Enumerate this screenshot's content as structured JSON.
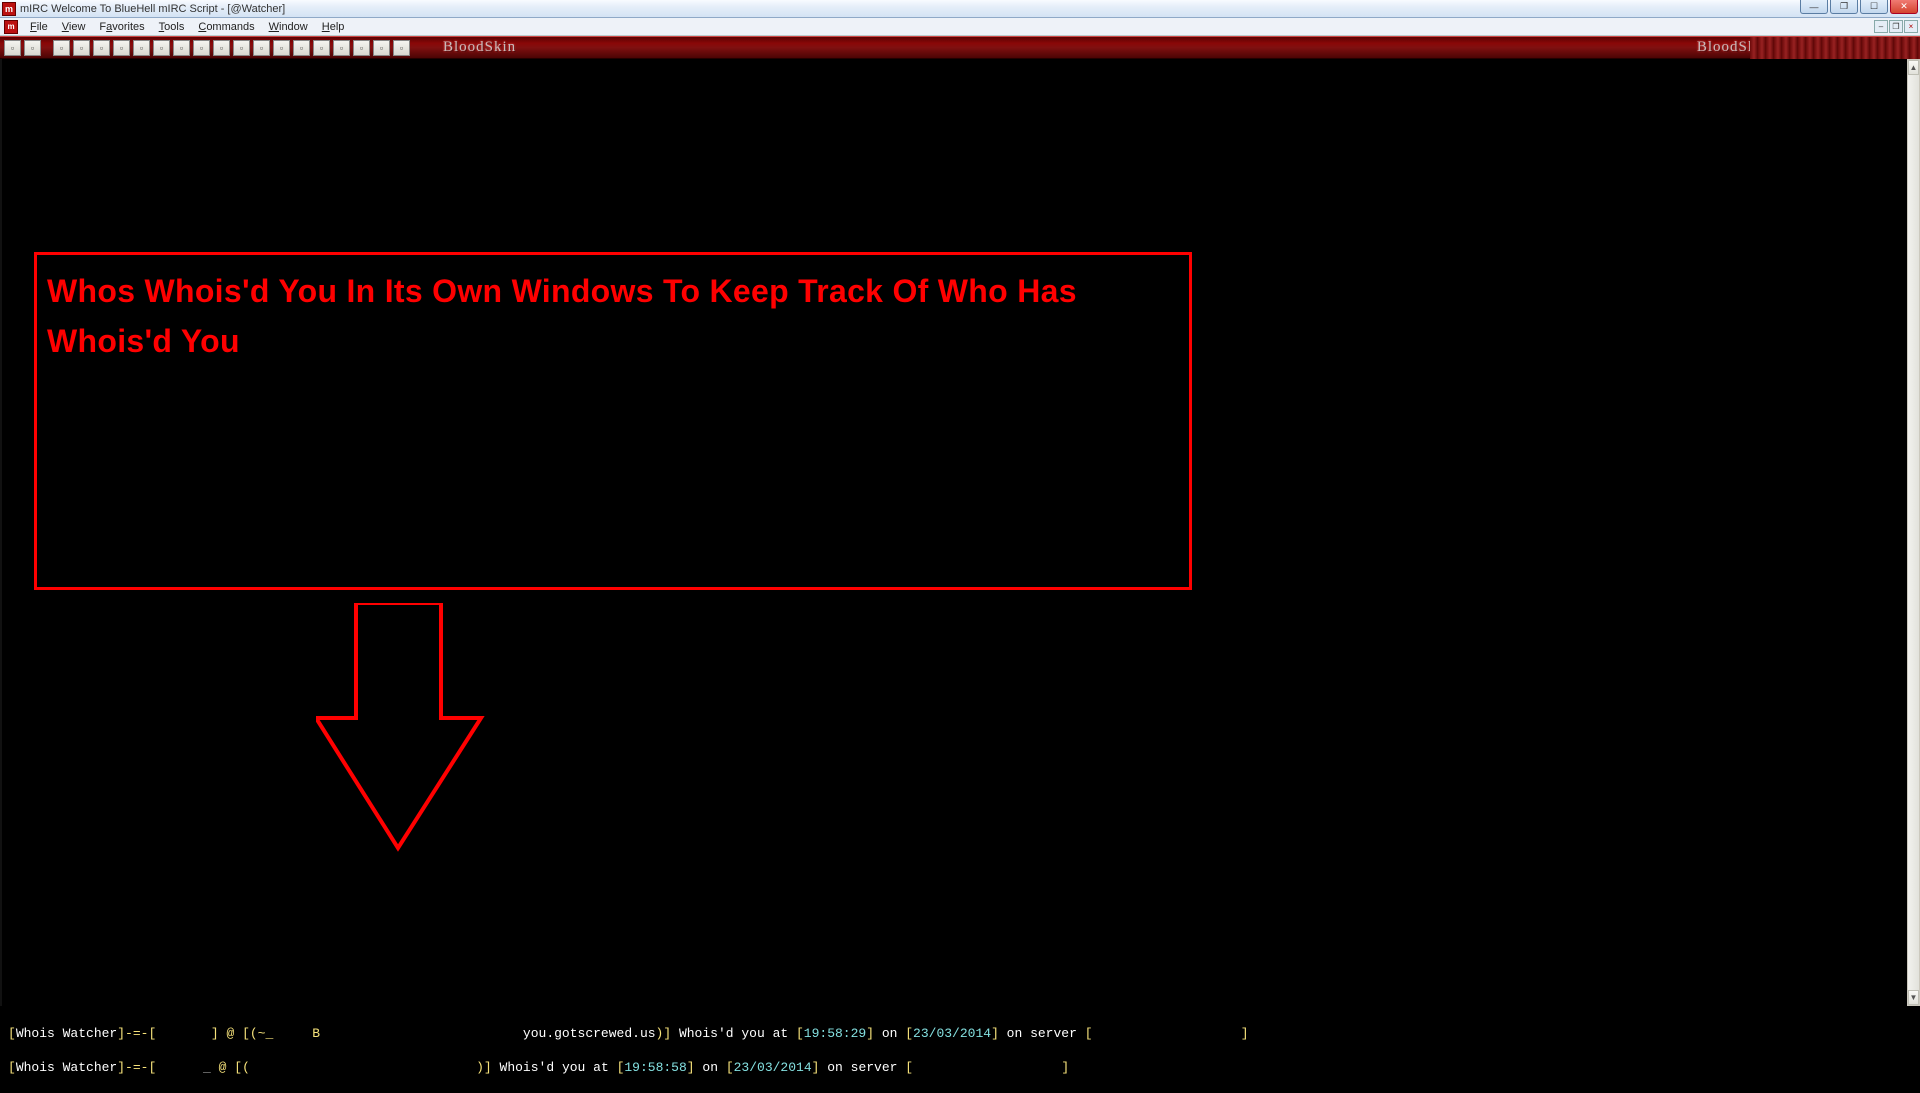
{
  "window": {
    "title": "mIRC Welcome To BlueHell mIRC Script - [@Watcher]"
  },
  "menu": {
    "file": "File",
    "view": "View",
    "favorites": "Favorites",
    "tools": "Tools",
    "commands": "Commands",
    "window": "Window",
    "help": "Help"
  },
  "brand": "BloodSkin",
  "callout": {
    "text": "Whos Whois'd You In Its Own Windows To Keep Track Of Who Has Whois'd You"
  },
  "log": {
    "line1": {
      "prefix": "[",
      "label": "Whois Watcher",
      "sep1": "]-=-[",
      "blank1": "       ",
      "mid1": "] @ [(~_     B",
      "host": "you.gotscrewed.us",
      "after_host": ")] ",
      "msg": "Whois'd you at ",
      "b1": "[",
      "time": "19:58:29",
      "b2": "] ",
      "on": "on ",
      "b3": "[",
      "date": "23/03/2014",
      "b4": "] ",
      "srv": "on server ",
      "b5": "[",
      "tail_close": "]"
    },
    "line2": {
      "prefix": "[",
      "label": "Whois Watcher",
      "sep1": "]-=-[",
      "blank1": "      _",
      "mid1": " @ [(",
      "host_close": ")] ",
      "msg": "Whois'd you at ",
      "b1": "[",
      "time": "19:58:58",
      "b2": "] ",
      "on": "on ",
      "b3": "[",
      "date": "23/03/2014",
      "b4": "] ",
      "srv": "on server ",
      "b5": "[",
      "tail_close": "]"
    }
  }
}
